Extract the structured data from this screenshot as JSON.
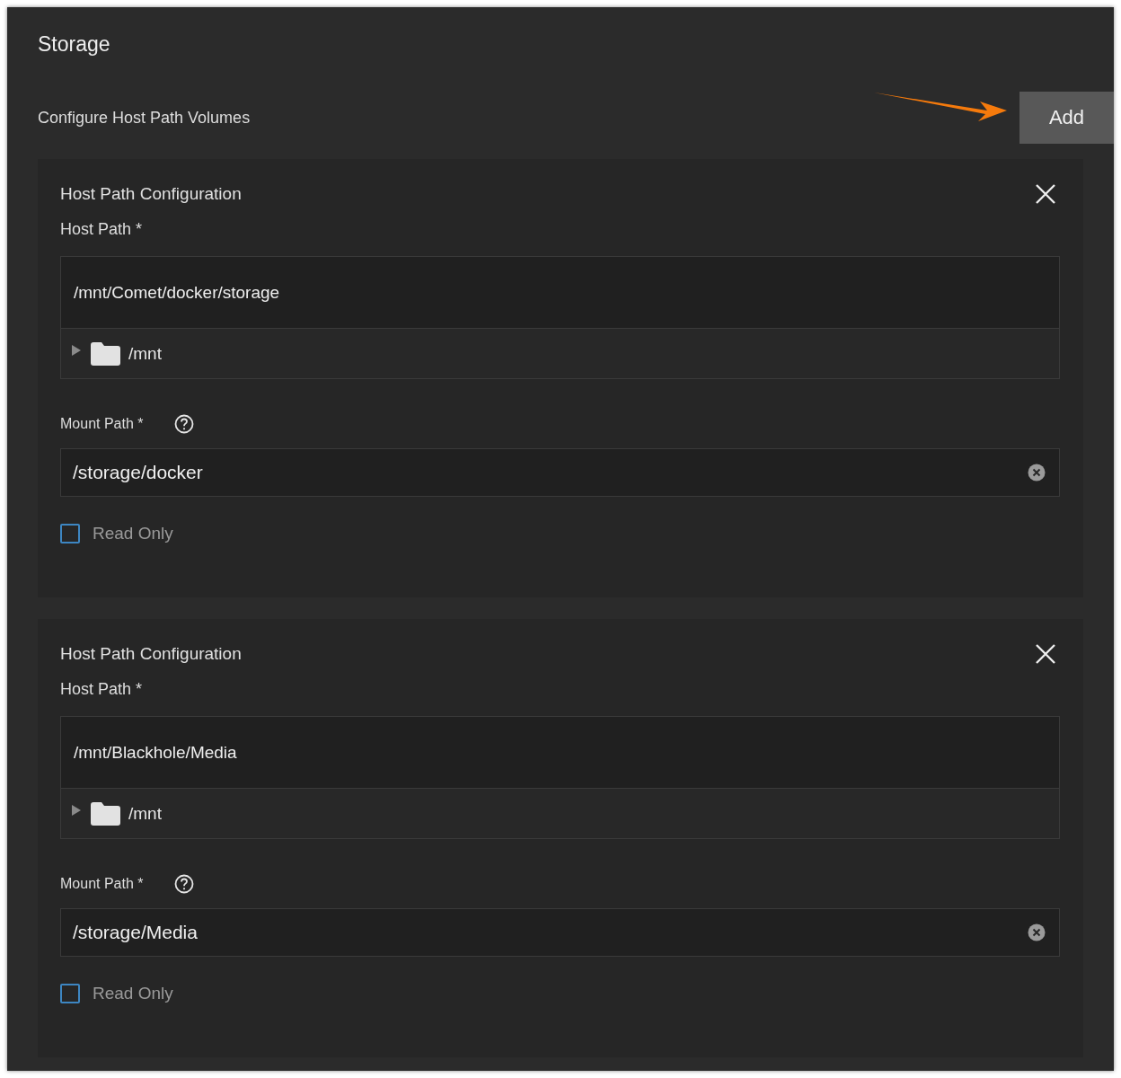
{
  "section": {
    "title": "Storage",
    "subtitle": "Configure Host Path Volumes"
  },
  "add_button": {
    "label": "Add"
  },
  "configurations": [
    {
      "title": "Host Path Configuration",
      "host_path_label": "Host Path *",
      "host_path_value": "/mnt/Comet/docker/storage",
      "tree": {
        "label": "/mnt",
        "expanded": false
      },
      "mount_path_label": "Mount Path *",
      "mount_path_value": "/storage/docker",
      "read_only": {
        "label": "Read Only",
        "checked": false
      }
    },
    {
      "title": "Host Path Configuration",
      "host_path_label": "Host Path *",
      "host_path_value": "/mnt/Blackhole/Media",
      "tree": {
        "label": "/mnt",
        "expanded": false
      },
      "mount_path_label": "Mount Path *",
      "mount_path_value": "/storage/Media",
      "read_only": {
        "label": "Read Only",
        "checked": false
      }
    }
  ]
}
